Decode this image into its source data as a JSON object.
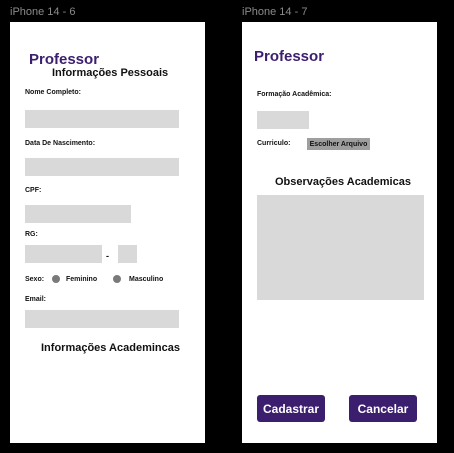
{
  "frame_left": {
    "frame_label": "iPhone 14 - 6",
    "title": "Professor",
    "section_personal": "Informações Pessoais",
    "full_name_label": "Nome Completo:",
    "birth_date_label": "Data De Nascimento:",
    "cpf_label": "CPF:",
    "rg_label": "RG:",
    "rg_separator": "-",
    "sex_label": "Sexo:",
    "sex_female": "Feminino",
    "sex_male": "Masculino",
    "email_label": "Email:",
    "section_academic": "Informações Academincas"
  },
  "frame_right": {
    "frame_label": "iPhone 14 - 7",
    "title": "Professor",
    "education_label": "Formação Acadêmica:",
    "curriculum_label": "Curriculo:",
    "choose_file_label": "Escolher Arquivo",
    "notes_heading": "Observações Academicas",
    "register_button": "Cadastrar",
    "cancel_button": "Cancelar"
  },
  "colors": {
    "brand": "#3c1e6e",
    "field": "#d9d9d9"
  }
}
